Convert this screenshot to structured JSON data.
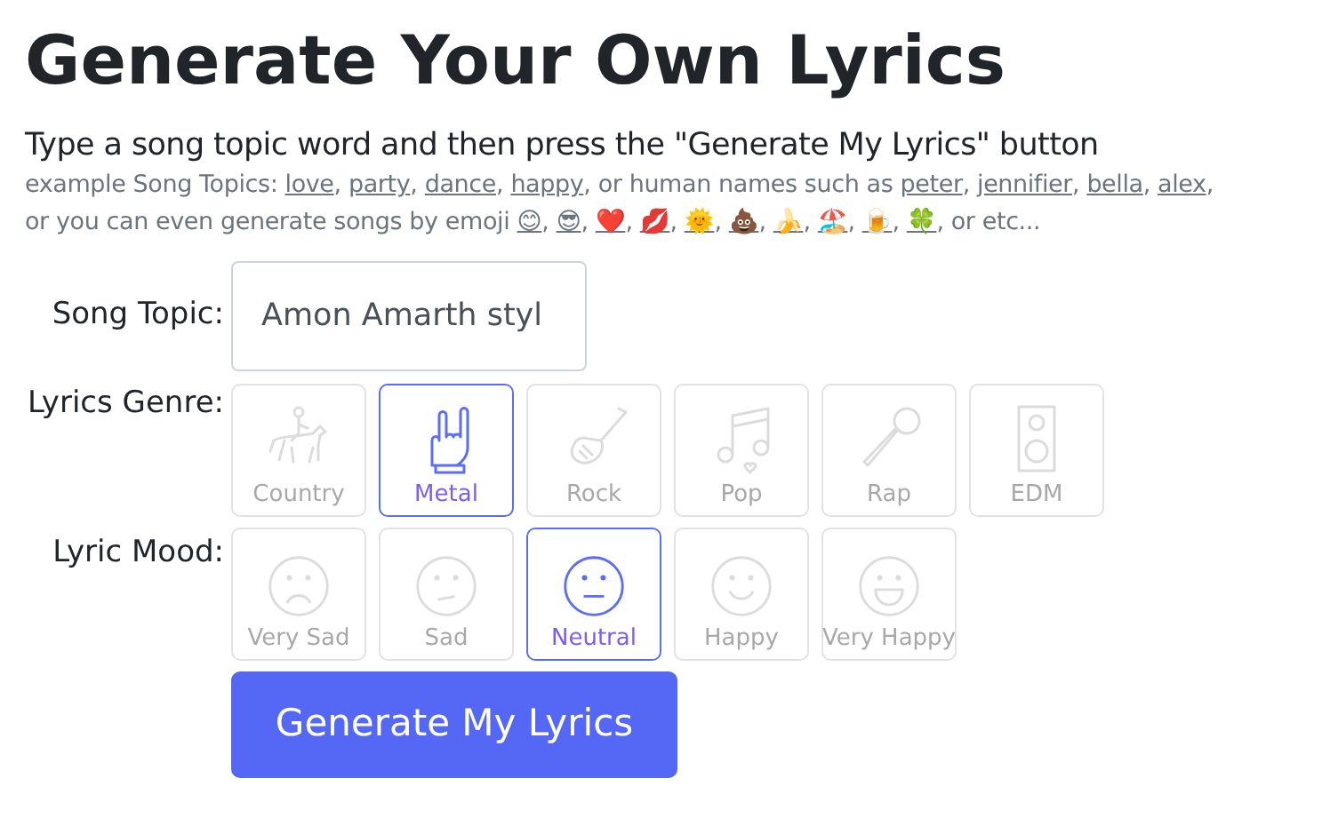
{
  "title": "Generate Your Own Lyrics",
  "instructions": "Type a song topic word and then press the \"Generate My Lyrics\" button",
  "examples": {
    "prefix": "example Song Topics:",
    "words": [
      "love",
      "party",
      "dance",
      "happy"
    ],
    "middle": ", or human names such as",
    "names": [
      "peter",
      "jennifier",
      "bella",
      "alex"
    ],
    "emoji_prefix": "or you can even generate songs by emoji",
    "emojis": [
      "😊",
      "😎",
      "❤️",
      "💋",
      "🌞",
      "💩",
      "🍌",
      "🏖️",
      "🍺",
      "🍀"
    ],
    "suffix": "or etc...",
    "separator": ","
  },
  "song_topic": {
    "label": "Song Topic:",
    "value": "Amon Amarth styl"
  },
  "genre": {
    "label": "Lyrics Genre:",
    "options": [
      {
        "kind": "country",
        "label": "Country",
        "selected": false
      },
      {
        "kind": "metal",
        "label": "Metal",
        "selected": true
      },
      {
        "kind": "rock",
        "label": "Rock",
        "selected": false
      },
      {
        "kind": "pop",
        "label": "Pop",
        "selected": false
      },
      {
        "kind": "rap",
        "label": "Rap",
        "selected": false
      },
      {
        "kind": "edm",
        "label": "EDM",
        "selected": false
      }
    ]
  },
  "mood": {
    "label": "Lyric Mood:",
    "options": [
      {
        "kind": "very_sad",
        "label": "Very Sad",
        "selected": false
      },
      {
        "kind": "sad",
        "label": "Sad",
        "selected": false
      },
      {
        "kind": "neutral",
        "label": "Neutral",
        "selected": true
      },
      {
        "kind": "happy",
        "label": "Happy",
        "selected": false
      },
      {
        "kind": "very_happy",
        "label": "Very Happy",
        "selected": false
      }
    ]
  },
  "submit": "Generate My Lyrics"
}
